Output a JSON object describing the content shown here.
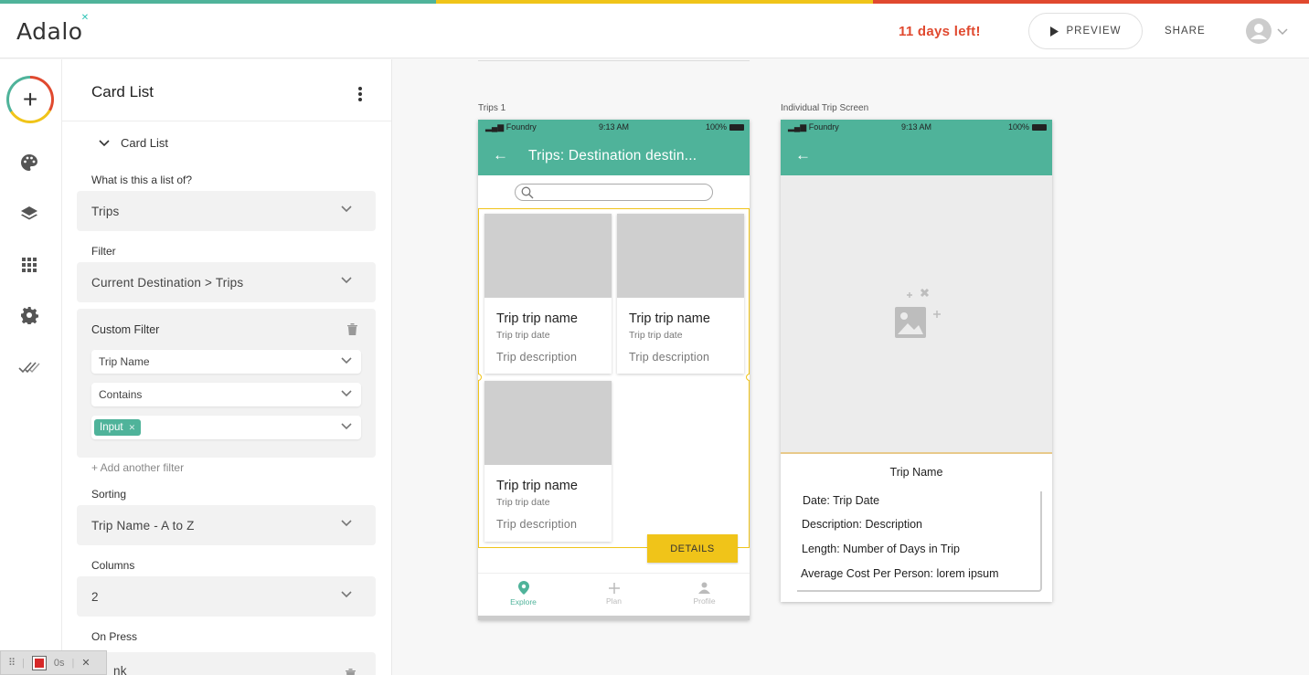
{
  "colors": {
    "red": "#e0492f",
    "yellow": "#f0c419",
    "green": "#4fb39a",
    "teal_stripe": "#4fb39a"
  },
  "header": {
    "logo_text": "Adalo",
    "trial_text": "11 days left!",
    "preview_label": "PREVIEW",
    "share_label": "SHARE"
  },
  "rail": {
    "icons": [
      "add-icon",
      "palette-icon",
      "layers-icon",
      "grid-icon",
      "gear-icon",
      "double-check-icon"
    ]
  },
  "panel": {
    "title": "Card List",
    "section": "Card List",
    "list_of_label": "What is this a list of?",
    "list_of_value": "Trips",
    "filter_label": "Filter",
    "filter_value": "Current Destination > Trips",
    "custom_filter": {
      "title": "Custom Filter",
      "field": "Trip Name",
      "operator": "Contains",
      "value_pill": "Input"
    },
    "add_filter": "+ Add another filter",
    "sorting_label": "Sorting",
    "sorting_value": "Trip Name - A to Z",
    "columns_label": "Columns",
    "columns_value": "2",
    "on_press_label": "On Press",
    "on_press_value": "nk"
  },
  "recorder": {
    "time": "0s"
  },
  "screens": {
    "trips": {
      "label": "Trips 1",
      "status_carrier": "Foundry",
      "status_time": "9:13 AM",
      "status_battery": "100%",
      "title": "Trips: Destination destin...",
      "cards": [
        {
          "name": "Trip trip name",
          "date": "Trip trip date",
          "desc": "Trip description"
        },
        {
          "name": "Trip trip name",
          "date": "Trip trip date",
          "desc": "Trip description"
        },
        {
          "name": "Trip trip name",
          "date": "Trip trip date",
          "desc": "Trip description"
        }
      ],
      "details_button": "DETAILS",
      "tabs": [
        {
          "label": "Explore"
        },
        {
          "label": "Plan"
        },
        {
          "label": "Profile"
        }
      ]
    },
    "trip_detail": {
      "label": "Individual Trip Screen",
      "status_carrier": "Foundry",
      "status_time": "9:13 AM",
      "status_battery": "100%",
      "heading": "Trip Name",
      "lines": [
        "Date: Trip Date",
        "Description: Description",
        "Length: Number of Days in Trip",
        "Average Cost Per Person: lorem ipsum"
      ]
    }
  }
}
